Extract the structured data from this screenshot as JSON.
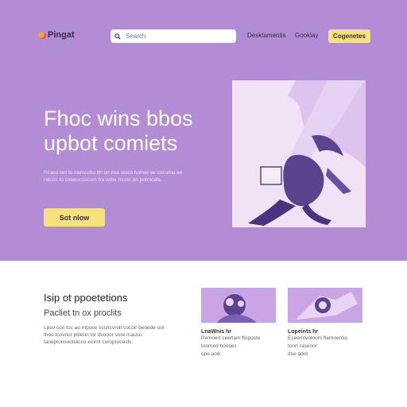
{
  "header": {
    "logo_text": "Pingat",
    "search_placeholder": "Search",
    "nav": [
      "Desktamentis",
      "Gooklay"
    ],
    "cta_label": "Cogenetes"
  },
  "hero": {
    "headline_line1": "Fhoc wins bbos",
    "headline_line2": "upbot comiets",
    "subtext": "Rcaso ont lo rremccho tlh on coa stocs hohne ve cocuroo ae ratcos to oxterocsscom tra wtbe mone an potmcets.",
    "button_label": "Sot nlow"
  },
  "section": {
    "title": "Isip ot ppoetetions",
    "subtitle": "Pacliet tn ox proclits",
    "body": "Lpso coo toc ao mpoce sccrtcvrolt cocolr beoede oor thoo tcovrlor ptilenn tor dvooor sore mauso taoeptonsoolslicco eiornt coroprocesfs."
  },
  "cards": [
    {
      "title": "LnaWnis hr",
      "body": "Pemoert ceerlam ftoposte\ntoomed hooses\nope aod."
    },
    {
      "title": "Lopeints hr",
      "body": "Eceemtvoloom ftemoentio\ntonrt rasenor\ndoe adol."
    }
  ],
  "colors": {
    "hero_bg": "#b38cd6",
    "accent_yellow": "#f7e27a"
  }
}
